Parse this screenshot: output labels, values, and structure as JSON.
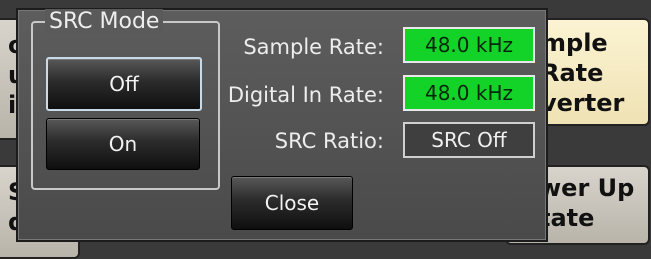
{
  "background": {
    "left_top_label": "o\nu\ni",
    "left_bottom_label": "S\nd",
    "right_top_label": "mple\nRate\nverter",
    "right_bottom_label": "wer Up\ntate"
  },
  "dialog": {
    "group_title": "SRC Mode",
    "off_label": "Off",
    "on_label": "On",
    "sample_rate_label": "Sample Rate:",
    "sample_rate_value": "48.0 kHz",
    "digital_in_label": "Digital In Rate:",
    "digital_in_value": "48.0 kHz",
    "ratio_label": "SRC Ratio:",
    "ratio_value": "SRC Off",
    "close_label": "Close"
  },
  "colors": {
    "status_ok": "#13d329",
    "dialog_bg": "#4f4f4f",
    "selected_border": "#c9dbe9"
  }
}
